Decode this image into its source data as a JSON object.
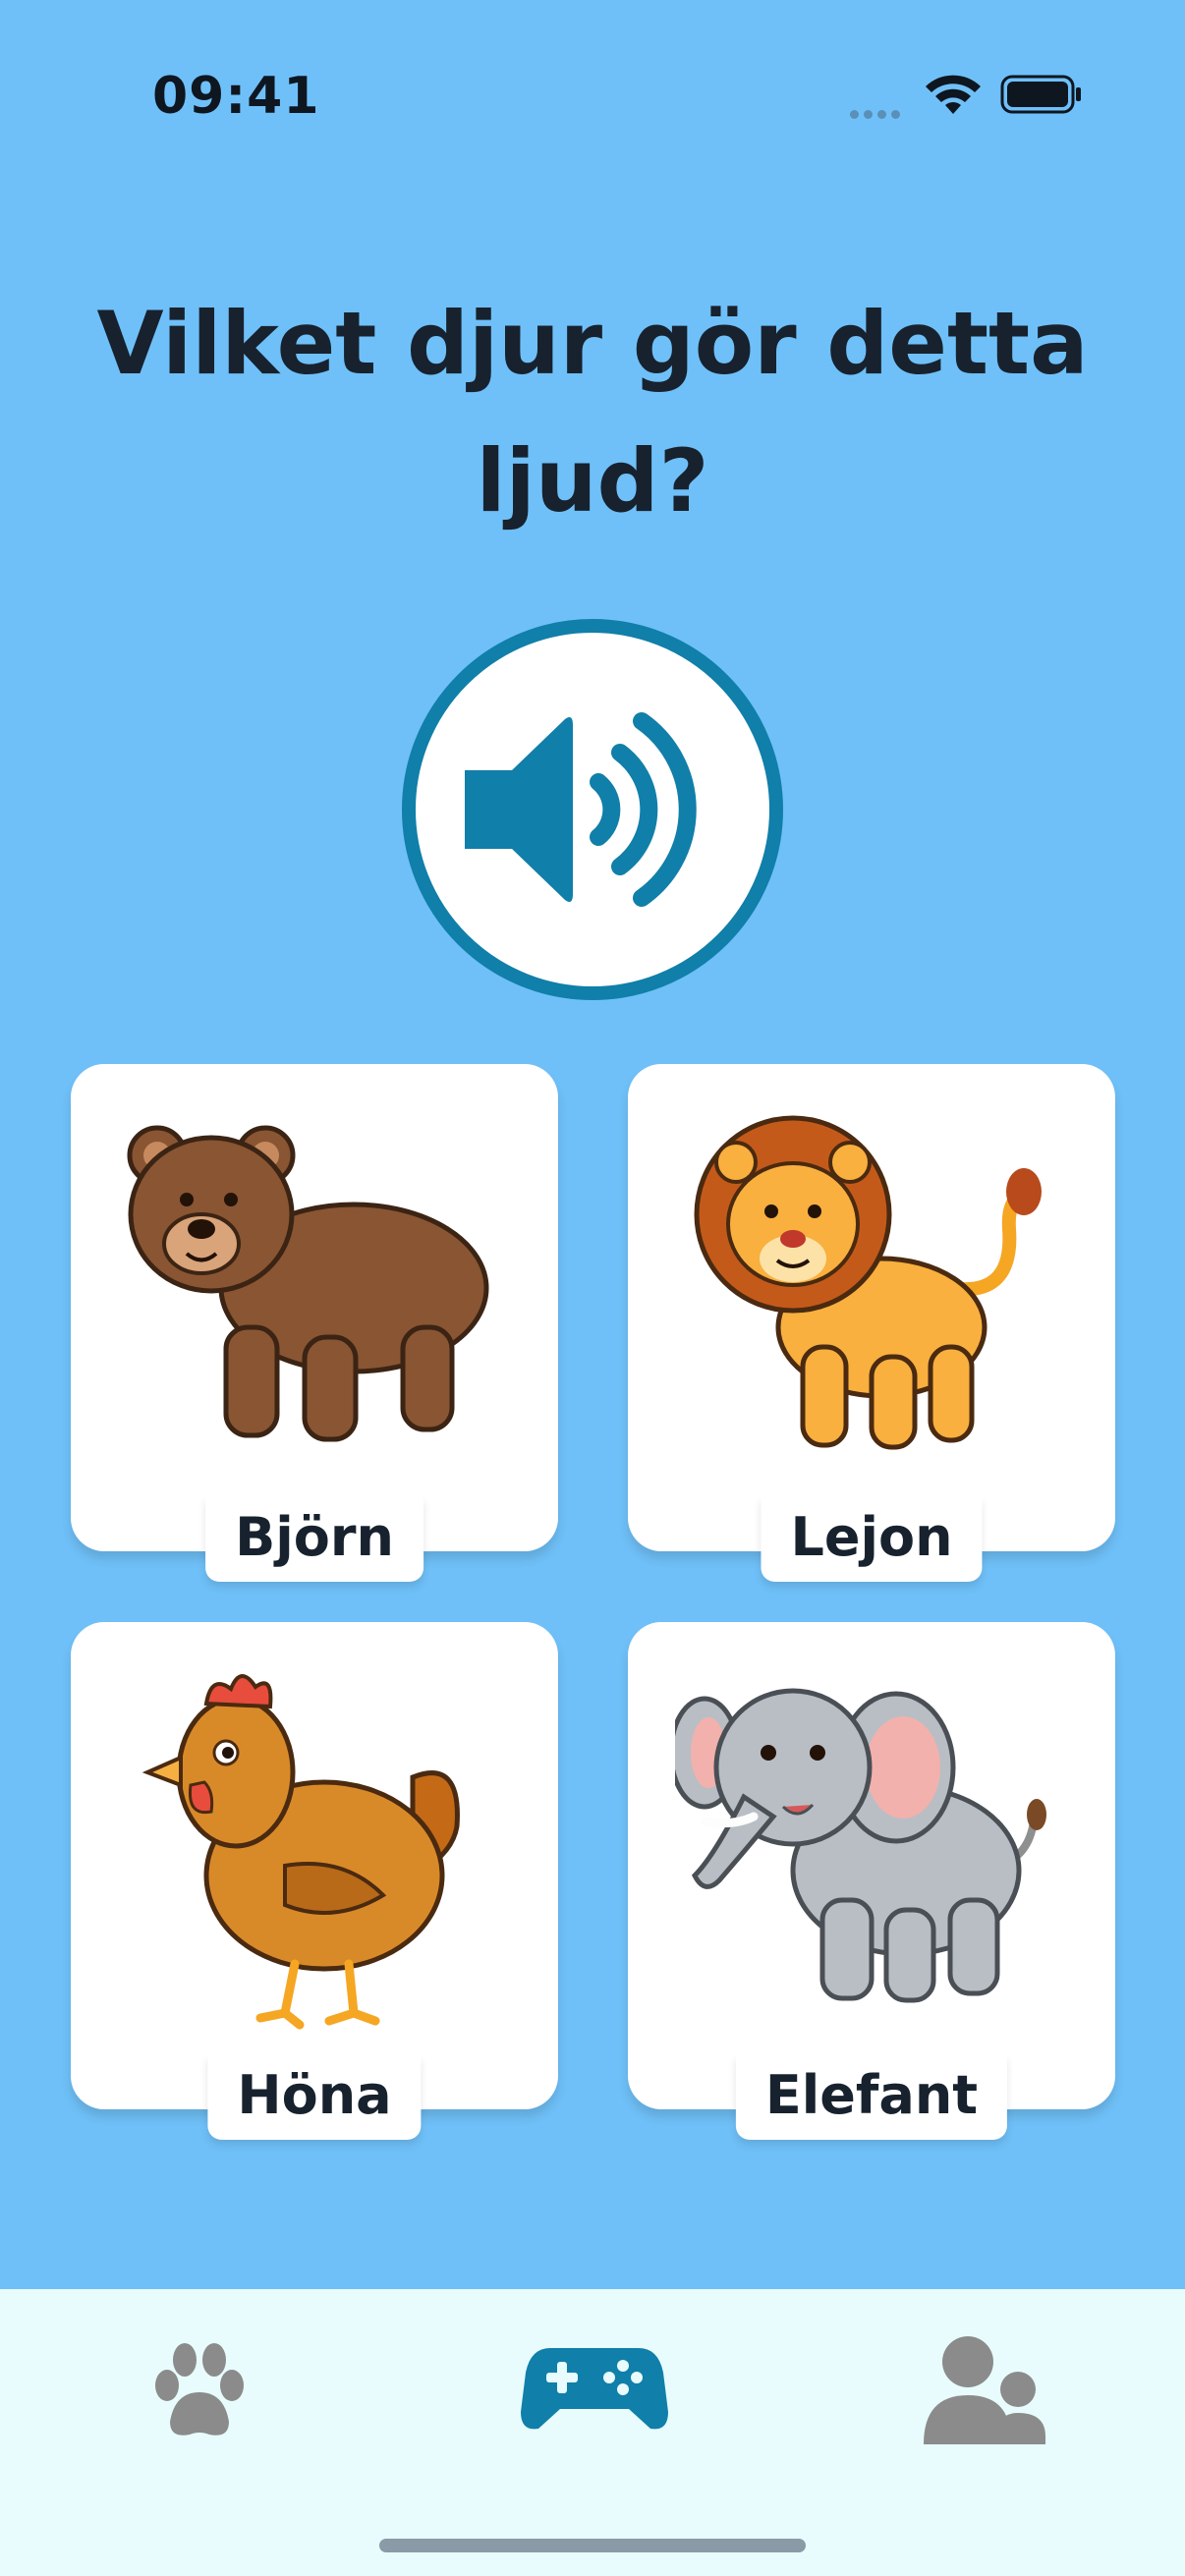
{
  "status_bar": {
    "time": "09:41",
    "icons": [
      "signal-dots-icon",
      "wifi-icon",
      "battery-icon"
    ]
  },
  "question": {
    "text": "Vilket djur gör detta ljud?"
  },
  "sound_button": {
    "icon": "speaker-icon",
    "accent": "#107fa9"
  },
  "answers": [
    {
      "id": "bear",
      "label": "Björn",
      "icon": "bear-illustration"
    },
    {
      "id": "lion",
      "label": "Lejon",
      "icon": "lion-illustration"
    },
    {
      "id": "hen",
      "label": "Höna",
      "icon": "hen-illustration"
    },
    {
      "id": "elephant",
      "label": "Elefant",
      "icon": "elephant-illustration"
    }
  ],
  "tab_bar": {
    "tabs": [
      {
        "id": "animals",
        "icon": "paw-icon",
        "active": false
      },
      {
        "id": "games",
        "icon": "gamepad-icon",
        "active": true
      },
      {
        "id": "profile",
        "icon": "users-icon",
        "active": false
      }
    ],
    "active_color": "#107fa9",
    "inactive_color": "#8b8b8b"
  },
  "colors": {
    "background": "#6fc0f8",
    "card": "#ffffff",
    "text": "#17222e"
  }
}
